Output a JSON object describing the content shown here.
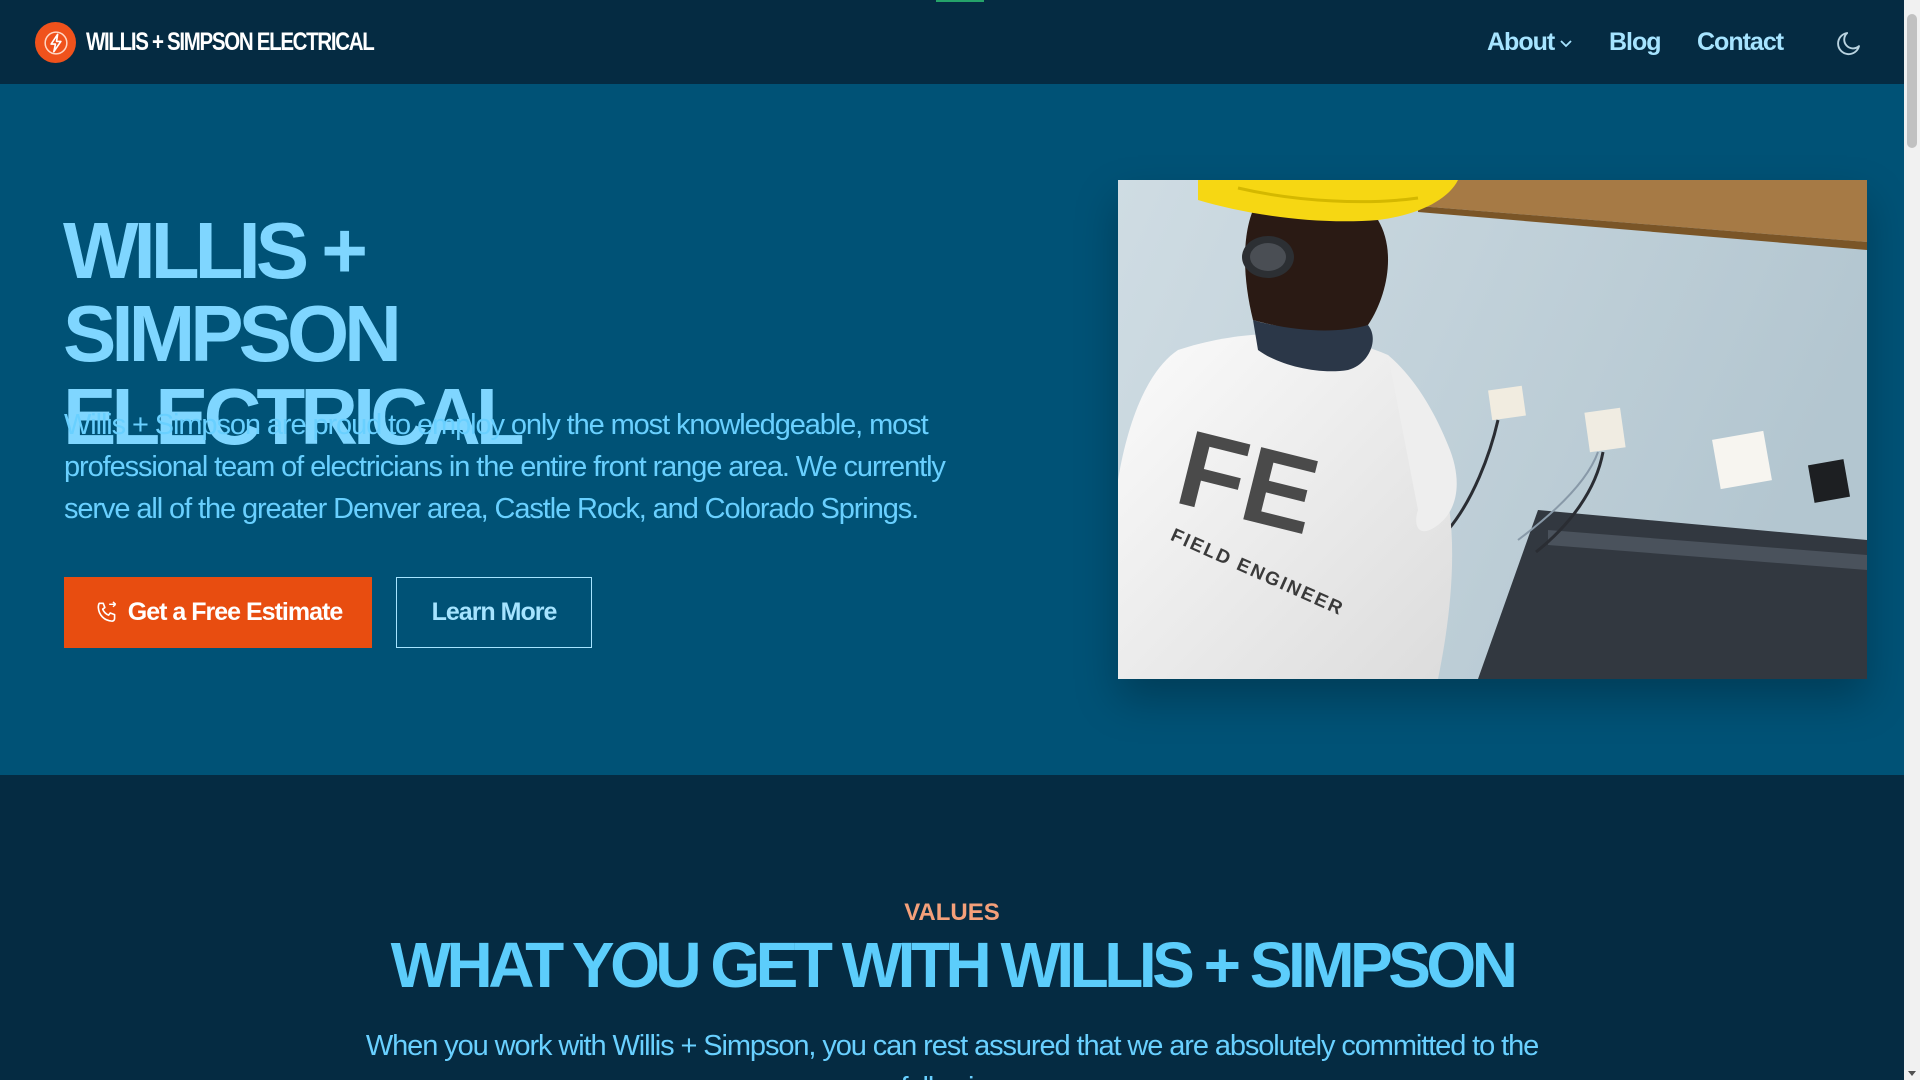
{
  "nav": {
    "brand": "WILLIS + SIMPSON ELECTRICAL",
    "logo_icon": "lightning-bolt-icon",
    "links": [
      {
        "label": "About",
        "has_dropdown": true
      },
      {
        "label": "Blog"
      },
      {
        "label": "Contact"
      }
    ],
    "theme_toggle_icon": "moon-icon"
  },
  "hero": {
    "title": "WILLIS + SIMPSON ELECTRICAL",
    "text": "Willis + Simpson are proud to employ only the most knowledgeable, most professional team of electricians in the entire front range area. We currently serve all of the greater Denver area, Castle Rock, and Colorado Springs.",
    "primary_button": {
      "label": "Get a Free Estimate",
      "icon": "phone-icon"
    },
    "secondary_button": {
      "label": "Learn More"
    },
    "image_shirt_letters": "FE",
    "image_shirt_text": "FIELD ENGINEER"
  },
  "values": {
    "eyebrow": "VALUES",
    "title": "WHAT YOU GET WITH WILLIS + SIMPSON",
    "text": "When you work with Willis + Simpson, you can rest assured that we are absolutely committed to the following"
  },
  "colors": {
    "nav_bg": "#052b42",
    "hero_bg": "#005276",
    "accent_orange": "#e84d10",
    "heading_blue": "#7fd6ff",
    "text_blue": "#69d0ff",
    "eyebrow": "#f4a07a"
  }
}
